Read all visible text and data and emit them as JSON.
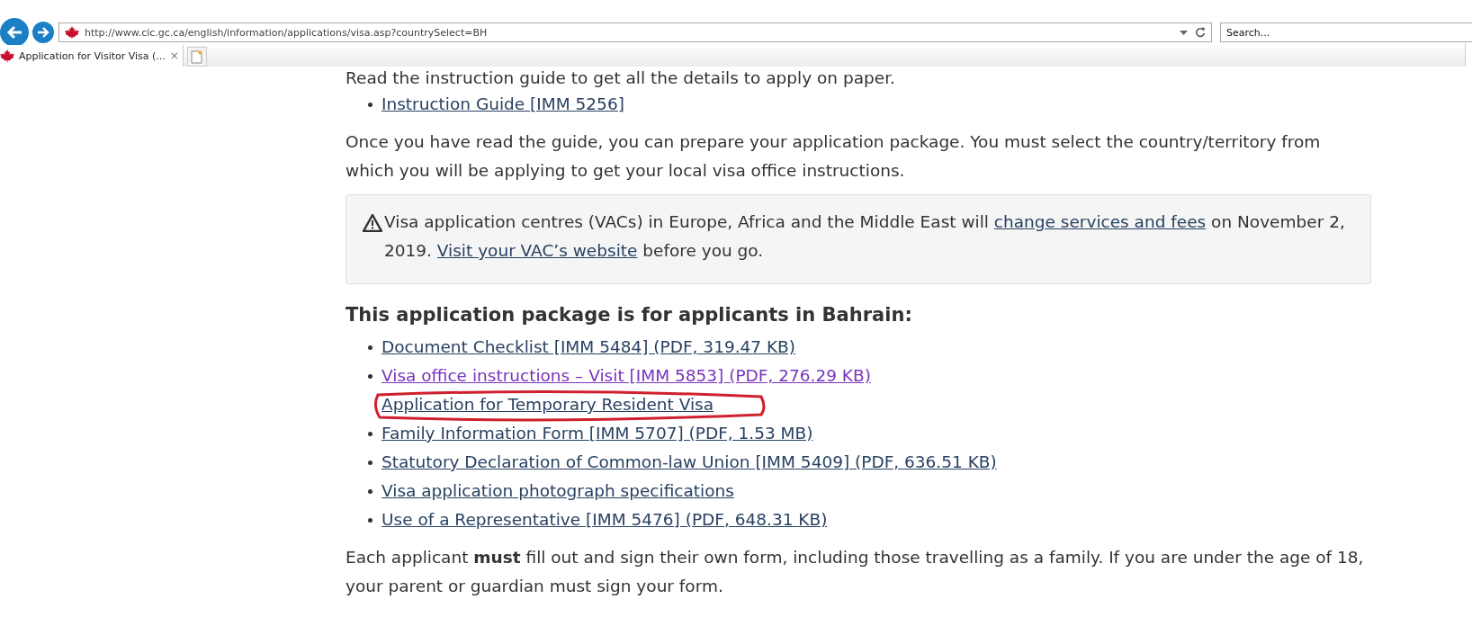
{
  "browser": {
    "address": "http://www.cic.gc.ca/english/information/applications/visa.asp?countrySelect=BH",
    "search": {
      "placeholder": "Search..."
    },
    "tabs": [
      {
        "label": "Application for Visitor Visa (...",
        "close": "×",
        "selected": true
      }
    ]
  },
  "page": {
    "cut_line": "Read the instruction guide to get all the details to apply on paper.",
    "guide_links": [
      {
        "text": "Instruction Guide [IMM 5256]",
        "visited": false,
        "highlighted": false
      }
    ],
    "intro": "Once you have read the guide, you can prepare your application package. You must select the country/territory from which you will be applying to get your local visa office instructions.",
    "alert": {
      "parts": [
        {
          "kind": "text",
          "text": "Visa application centres (VACs) in Europe, Africa and the Middle East will "
        },
        {
          "kind": "link",
          "text": "change services and fees"
        },
        {
          "kind": "text",
          "text": " on November 2, 2019. "
        },
        {
          "kind": "link",
          "text": "Visit your VAC’s website"
        },
        {
          "kind": "text",
          "text": " before you go."
        }
      ]
    },
    "heading": "This application package is for applicants in Bahrain:",
    "links": [
      {
        "text": "Document Checklist [IMM 5484] (PDF, 319.47 KB)",
        "visited": false,
        "highlighted": false
      },
      {
        "text": "Visa office instructions – Visit [IMM 5853] (PDF, 276.29 KB)",
        "visited": true,
        "highlighted": false
      },
      {
        "text": "Application for Temporary Resident Visa",
        "visited": false,
        "highlighted": true
      },
      {
        "text": "Family Information Form [IMM 5707] (PDF, 1.53 MB)",
        "visited": false,
        "highlighted": false
      },
      {
        "text": "Statutory Declaration of Common-law Union [IMM 5409] (PDF, 636.51 KB)",
        "visited": false,
        "highlighted": false
      },
      {
        "text": "Visa application photograph specifications",
        "visited": false,
        "highlighted": false
      },
      {
        "text": "Use of a Representative [IMM 5476] (PDF, 648.31 KB)",
        "visited": false,
        "highlighted": false
      }
    ],
    "note": "Each applicant **must** fill out and sign their own form, including those travelling as a family. If you are under the age of 18, your parent or guardian must sign your form."
  }
}
